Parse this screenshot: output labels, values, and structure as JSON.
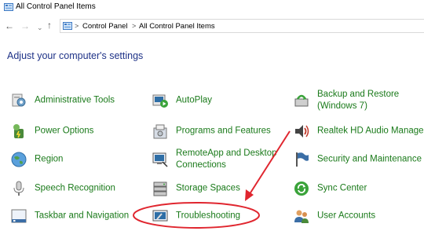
{
  "window": {
    "title": "All Control Panel Items"
  },
  "address": {
    "crumbs": [
      "Control Panel",
      "All Control Panel Items"
    ],
    "separator": ">",
    "nav": {
      "back": "←",
      "forward": "→",
      "dropdown": "⌄",
      "up": "↑"
    }
  },
  "header": {
    "subtitle": "Adjust your computer's settings"
  },
  "colors": {
    "link_green": "#1a7a1a",
    "subtitle_blue": "#1e3287",
    "annotation_red": "#e0262f"
  },
  "items": [
    {
      "label": "Administrative Tools",
      "icon": "admin-tools-icon"
    },
    {
      "label": "AutoPlay",
      "icon": "autoplay-icon"
    },
    {
      "label": "Backup and Restore\n(Windows 7)",
      "icon": "backup-restore-icon"
    },
    {
      "label": "Power Options",
      "icon": "power-options-icon"
    },
    {
      "label": "Programs and Features",
      "icon": "programs-features-icon"
    },
    {
      "label": "Realtek HD Audio Manager",
      "icon": "realtek-audio-icon"
    },
    {
      "label": "Region",
      "icon": "region-globe-icon"
    },
    {
      "label": "RemoteApp and Desktop\nConnections",
      "icon": "remoteapp-icon"
    },
    {
      "label": "Security and Maintenance",
      "icon": "security-flag-icon"
    },
    {
      "label": "Speech Recognition",
      "icon": "microphone-icon"
    },
    {
      "label": "Storage Spaces",
      "icon": "storage-spaces-icon"
    },
    {
      "label": "Sync Center",
      "icon": "sync-center-icon"
    },
    {
      "label": "Taskbar and Navigation",
      "icon": "taskbar-icon"
    },
    {
      "label": "Troubleshooting",
      "icon": "troubleshooting-icon"
    },
    {
      "label": "User Accounts",
      "icon": "user-accounts-icon"
    }
  ]
}
